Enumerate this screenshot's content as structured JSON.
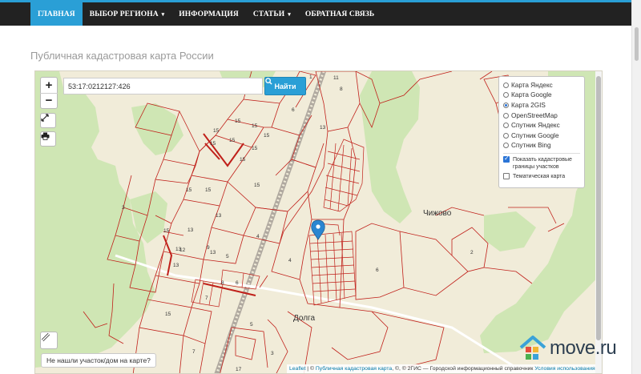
{
  "nav": {
    "items": [
      {
        "label": "ГЛАВНАЯ",
        "active": true,
        "dropdown": false
      },
      {
        "label": "ВЫБОР РЕГИОНА",
        "active": false,
        "dropdown": true
      },
      {
        "label": "ИНФОРМАЦИЯ",
        "active": false,
        "dropdown": false
      },
      {
        "label": "СТАТЬИ",
        "active": false,
        "dropdown": true
      },
      {
        "label": "ОБРАТНАЯ СВЯЗЬ",
        "active": false,
        "dropdown": false
      }
    ],
    "caret": "▾"
  },
  "page": {
    "title": "Публичная кадастровая карта России"
  },
  "map": {
    "zoom_in": "+",
    "zoom_out": "−",
    "search": {
      "value": "53:17:0212127:426",
      "button_label": "Найти"
    },
    "layers": {
      "options": [
        {
          "label": "Карта Яндекс",
          "selected": false
        },
        {
          "label": "Карта Google",
          "selected": false
        },
        {
          "label": "Карта 2GIS",
          "selected": true
        },
        {
          "label": "OpenStreetMap",
          "selected": false
        },
        {
          "label": "Спутник Яндекс",
          "selected": false
        },
        {
          "label": "Спутник Google",
          "selected": false
        },
        {
          "label": "Спутник Bing",
          "selected": false
        }
      ],
      "show_boundaries": {
        "label": "Показать кадастровые границы участков",
        "checked": true
      },
      "thematic": {
        "label": "Тематическая карта",
        "checked": false
      }
    },
    "not_found_label": "Не нашли участок/дом на карте?",
    "attribution": {
      "leaflet": "Leaflet",
      "sep": " | © ",
      "pkk": "Публичная кадастровая карта",
      "rest": ", ©, © 2ГИС — Городской информационный справочник",
      "terms": "Условия использования"
    },
    "places": {
      "chizhovo": "Чижово",
      "dolga": "Долга"
    },
    "parcel_labels": [
      "1",
      "11",
      "8",
      "4",
      "6",
      "2",
      "15",
      "15",
      "15",
      "15",
      "15",
      "15",
      "15",
      "15",
      "15",
      "15",
      "15",
      "15",
      "13",
      "13",
      "13",
      "13",
      "13",
      "13",
      "9",
      "3",
      "4",
      "4",
      "5",
      "6",
      "2",
      "7",
      "3",
      "17",
      "5",
      "12",
      "6",
      "8",
      "7",
      "15"
    ]
  },
  "watermark": {
    "text": "move.ru"
  },
  "colors": {
    "accent": "#2a9fd6",
    "navbar": "#222222",
    "parcel": "#c0201a",
    "forest": "#cfe6b4",
    "land": "#f1ecd9"
  }
}
